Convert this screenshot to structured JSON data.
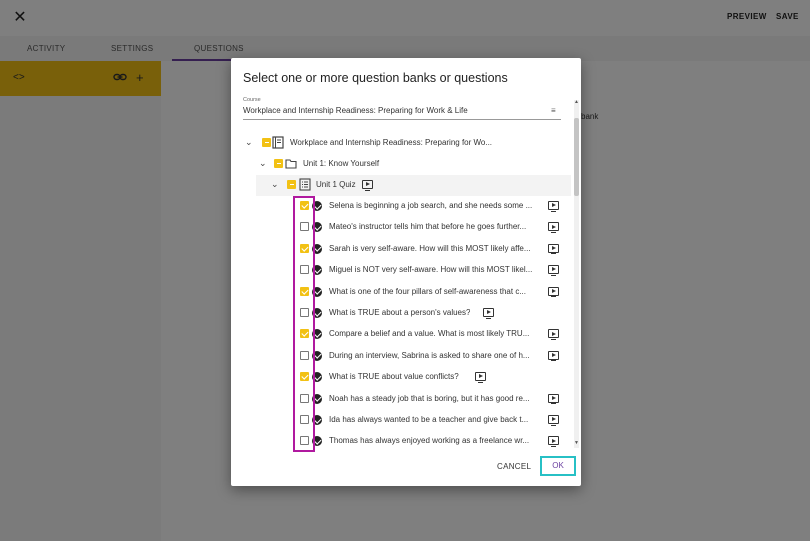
{
  "header": {
    "close_icon": "close-icon",
    "preview_label": "PREVIEW",
    "save_label": "SAVE"
  },
  "tabs": [
    {
      "label": "ACTIVITY"
    },
    {
      "label": "SETTINGS"
    },
    {
      "label": "QUESTIONS",
      "active": true
    }
  ],
  "left_panel": {
    "icons": [
      "code-icon",
      "link-icon",
      "plus-icon"
    ],
    "accent_color": "#f2c114"
  },
  "background_text": "bank",
  "dialog": {
    "title": "Select one or more question banks or questions",
    "course_label": "Course",
    "course_value": "Workplace and Internship Readiness: Preparing for Work & Life",
    "cancel_label": "CANCEL",
    "ok_label": "OK",
    "tree": {
      "course": {
        "label": "Workplace and Internship Readiness: Preparing for Wo...",
        "state": "partial"
      },
      "unit": {
        "label": "Unit 1: Know Yourself",
        "state": "partial"
      },
      "quiz": {
        "label": "Unit 1 Quiz",
        "state": "partial"
      },
      "questions": [
        {
          "label": "Selena is beginning a job search, and she needs some ...",
          "checked": true
        },
        {
          "label": "Mateo's instructor tells him that before he goes further...",
          "checked": false
        },
        {
          "label": "Sarah is very self-aware. How will this MOST likely affe...",
          "checked": true
        },
        {
          "label": "Miguel is NOT very self-aware. How will this MOST likel...",
          "checked": false
        },
        {
          "label": "What is one of the four pillars of self-awareness that c...",
          "checked": true
        },
        {
          "label": "What is TRUE about a person's values?",
          "checked": false
        },
        {
          "label": "Compare a belief and a value. What is most likely TRU...",
          "checked": true
        },
        {
          "label": "During an interview, Sabrina is asked to share one of h...",
          "checked": false
        },
        {
          "label": "What is TRUE about value conflicts?",
          "checked": true
        },
        {
          "label": "Noah has a steady job that is boring, but it has good re...",
          "checked": false
        },
        {
          "label": "Ida has always wanted to be a teacher and give back t...",
          "checked": false
        },
        {
          "label": "Thomas has always enjoyed working as a freelance wr...",
          "checked": false
        }
      ]
    }
  },
  "colors": {
    "accent_yellow": "#f2c114",
    "tab_underline": "#6a3fa0",
    "highlight_magenta": "#b0199f",
    "highlight_cyan": "#27c0c5"
  }
}
